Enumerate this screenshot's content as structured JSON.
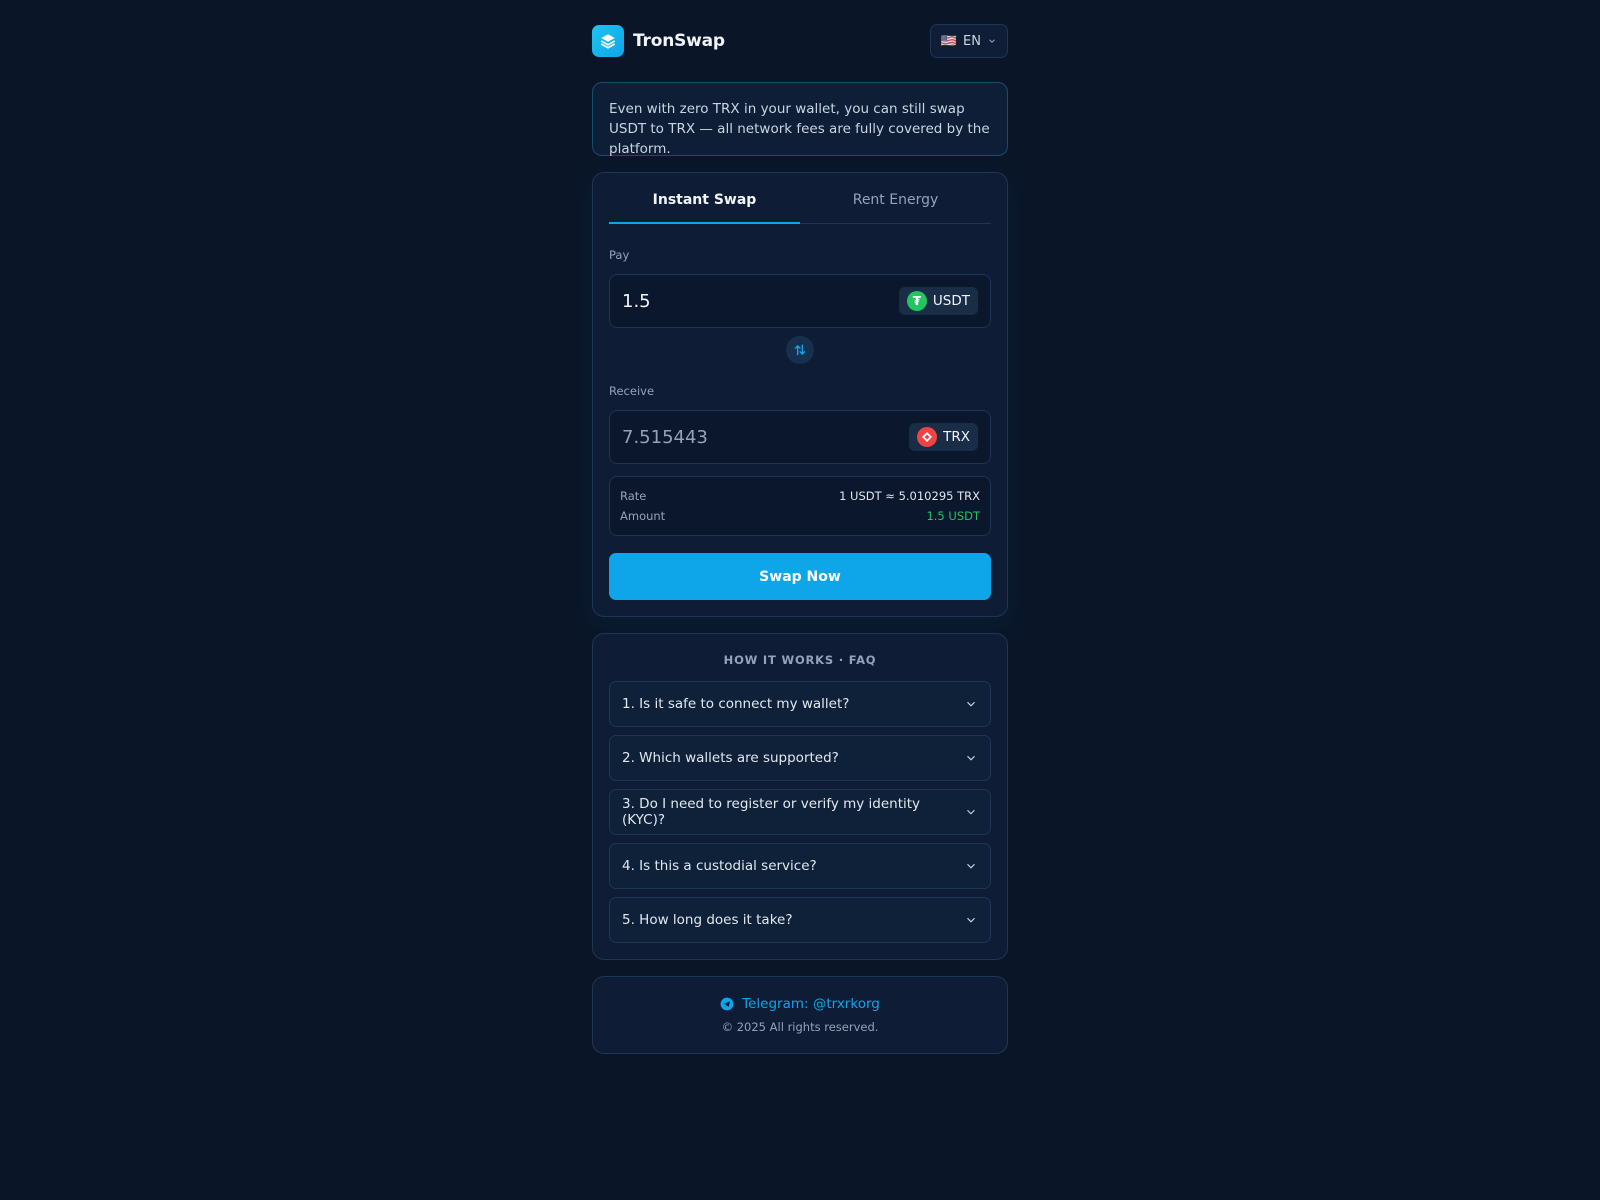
{
  "header": {
    "brand": "TronSwap",
    "language": {
      "flag": "🇺🇸",
      "code": "EN"
    }
  },
  "notice": "Even with zero TRX in your wallet, you can still swap USDT to TRX — all network fees are fully covered by the platform.",
  "swap": {
    "tabs": [
      {
        "label": "Instant Swap",
        "active": true
      },
      {
        "label": "Rent Energy",
        "active": false
      }
    ],
    "pay": {
      "label": "Pay",
      "value": "1.5",
      "token": "USDT",
      "token_symbol": "₮",
      "token_color": "#22c55e"
    },
    "receive": {
      "label": "Receive",
      "value": "7.515443",
      "token": "TRX",
      "token_color": "#ef4444"
    },
    "info": {
      "rate_label": "Rate",
      "rate_value": "1 USDT ≈ 5.010295 TRX",
      "amount_label": "Amount",
      "amount_value": "1.5 USDT"
    },
    "submit_label": "Swap Now"
  },
  "faq": {
    "title": "HOW IT WORKS · FAQ",
    "items": [
      "1. Is it safe to connect my wallet?",
      "2. Which wallets are supported?",
      "3. Do I need to register or verify my identity (KYC)?",
      "4. Is this a custodial service?",
      "5. How long does it take?"
    ]
  },
  "footer": {
    "telegram": "Telegram: @trxrkorg",
    "copyright": "© 2025 All rights reserved."
  },
  "colors": {
    "background": "#0a1628",
    "accent": "#0ea5e9",
    "success": "#22c55e",
    "trx": "#ef4444"
  },
  "icons": {
    "logo": "layers-icon",
    "language": "chevron-down-icon",
    "swap_direction": "swap-vertical-icon",
    "faq_expand": "chevron-down-icon",
    "telegram": "telegram-icon"
  }
}
